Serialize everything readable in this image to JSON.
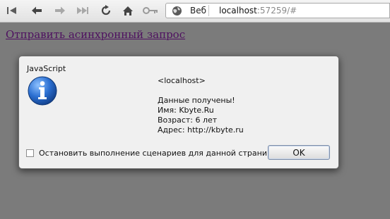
{
  "toolbar": {
    "buttons": [
      {
        "name": "first-page-icon"
      },
      {
        "name": "back-icon"
      },
      {
        "name": "forward-icon"
      },
      {
        "name": "fast-forward-icon"
      },
      {
        "name": "reload-icon"
      },
      {
        "name": "home-icon"
      },
      {
        "name": "key-icon"
      }
    ],
    "address": {
      "site_label": "Веб",
      "host": "localhost",
      "rest": ":57259/#"
    }
  },
  "page": {
    "link_text": "Отправить асинхронный запрос"
  },
  "dialog": {
    "title": "JavaScript",
    "icon": "info-icon",
    "host": "<localhost>",
    "message_lines": [
      "Данные получены!",
      "Имя: Kbyte.Ru",
      "Возраст: 6 лет",
      "Адрес: http://kbyte.ru"
    ],
    "checkbox_label": "Остановить выполнение сценариев для данной страницы",
    "checkbox_checked": false,
    "ok_label": "OK"
  },
  "colors": {
    "overlay": "#7b7b7b",
    "link": "#4e1060",
    "dialog_bg": "#f0f0f0",
    "info_blue": "#1f5fb8"
  }
}
